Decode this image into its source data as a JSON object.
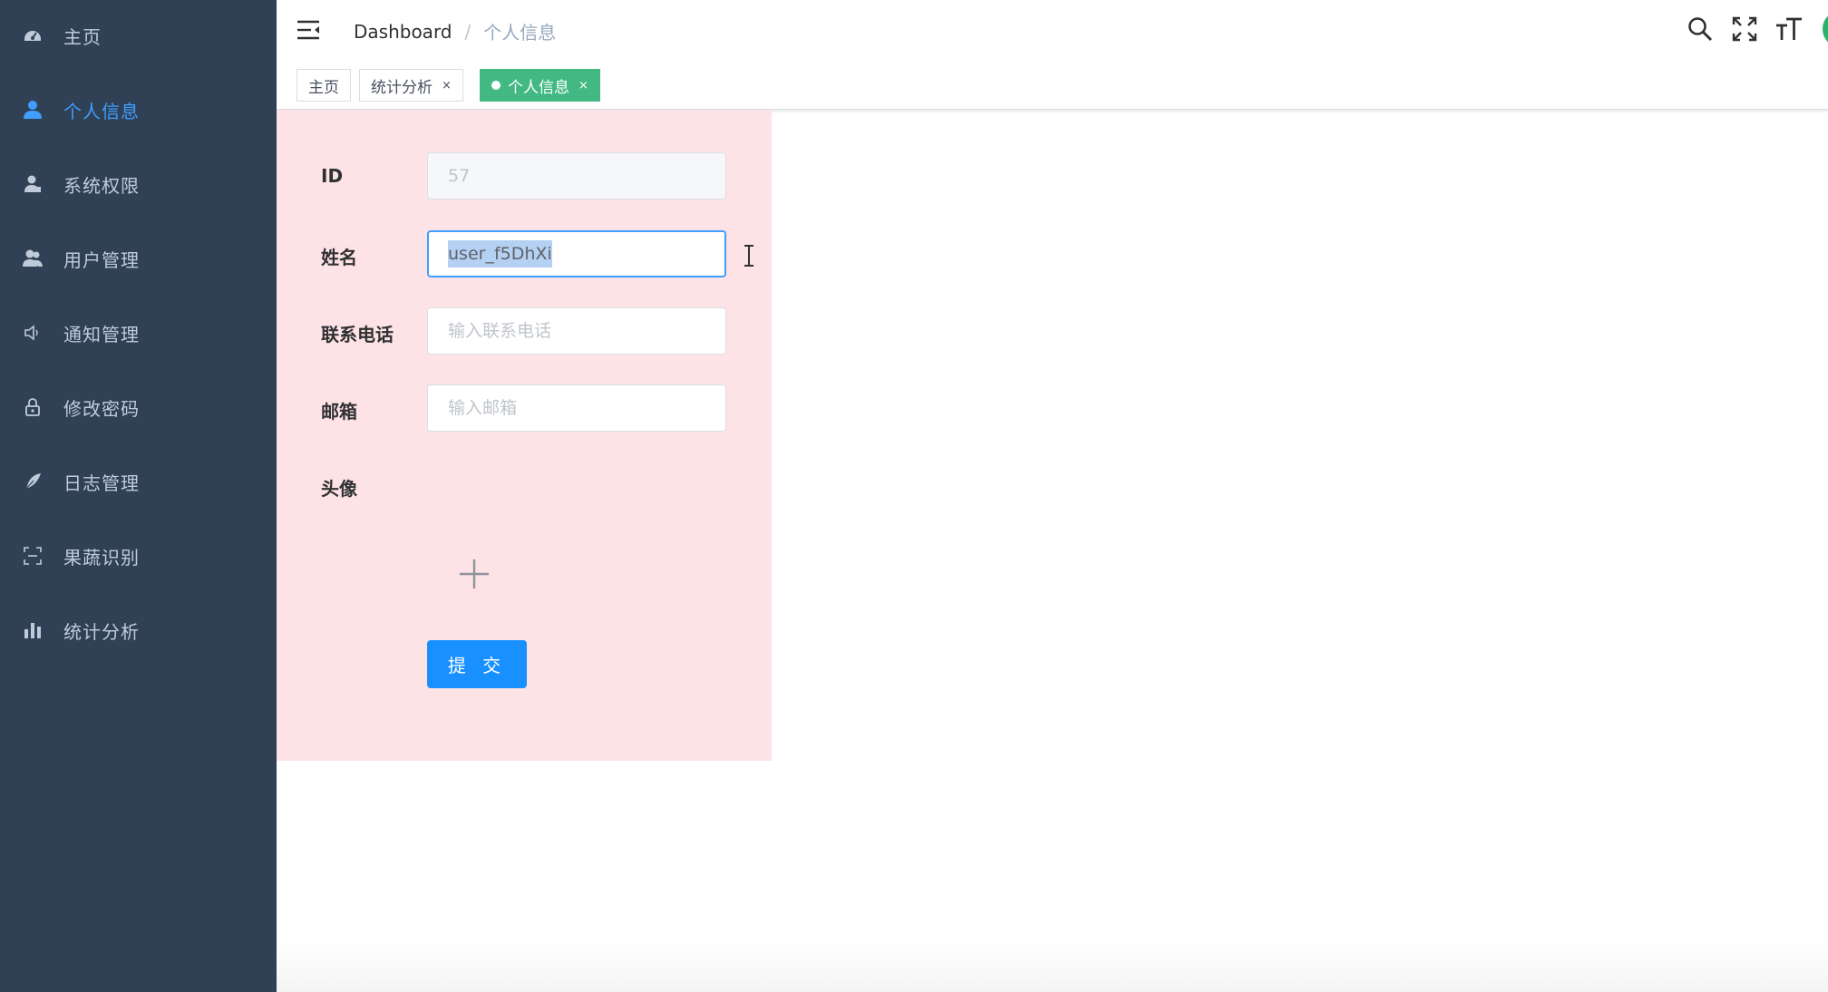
{
  "sidebar": {
    "items": [
      {
        "label": "主页",
        "icon": "dashboard-icon"
      },
      {
        "label": "个人信息",
        "icon": "user-icon",
        "active": true
      },
      {
        "label": "系统权限",
        "icon": "peoples-icon"
      },
      {
        "label": "用户管理",
        "icon": "users-icon"
      },
      {
        "label": "通知管理",
        "icon": "sound-icon"
      },
      {
        "label": "修改密码",
        "icon": "lock-icon"
      },
      {
        "label": "日志管理",
        "icon": "feather-icon"
      },
      {
        "label": "果蔬识别",
        "icon": "scan-icon"
      },
      {
        "label": "统计分析",
        "icon": "bar-chart-icon"
      }
    ]
  },
  "navbar": {
    "breadcrumb": {
      "root": "Dashboard",
      "separator": "/",
      "current": "个人信息"
    }
  },
  "tags": [
    {
      "label": "主页",
      "closable": false,
      "active": false
    },
    {
      "label": "统计分析",
      "closable": true,
      "active": false
    },
    {
      "label": "个人信息",
      "closable": true,
      "active": true
    }
  ],
  "tag_close_glyph": "×",
  "form": {
    "id": {
      "label": "ID",
      "value": "57"
    },
    "name": {
      "label": "姓名",
      "value": "user_f5DhXi"
    },
    "phone": {
      "label": "联系电话",
      "placeholder": "输入联系电话"
    },
    "email": {
      "label": "邮箱",
      "placeholder": "输入邮箱"
    },
    "avatar": {
      "label": "头像"
    },
    "submit_label": "提 交"
  },
  "colors": {
    "sidebar_bg": "#304156",
    "sidebar_text": "#bfcbd9",
    "active": "#409eff",
    "tag_active": "#42b983",
    "card_bg": "#fde2e6",
    "primary_button": "#1890ff"
  }
}
